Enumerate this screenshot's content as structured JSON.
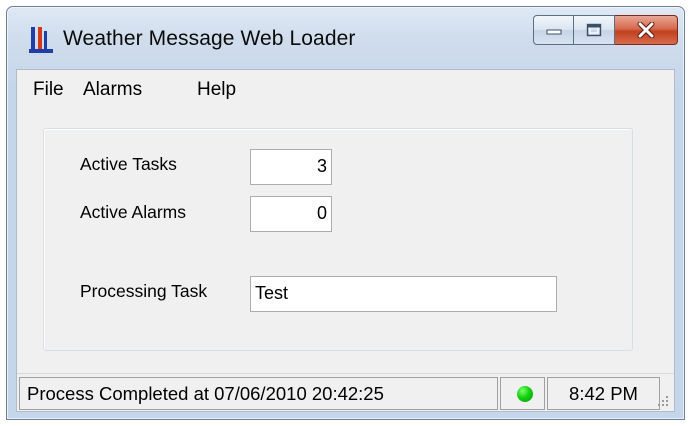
{
  "window": {
    "title": "Weather Message Web Loader",
    "icon": "app-logo-icon",
    "controls": [
      "minimize-icon",
      "maximize-icon",
      "close-icon"
    ]
  },
  "menu": {
    "items": [
      {
        "label": "File"
      },
      {
        "label": "Alarms"
      },
      {
        "label": "Help"
      }
    ]
  },
  "stats": {
    "active_tasks_label": "Active Tasks",
    "active_tasks_value": "3",
    "active_alarms_label": "Active Alarms",
    "active_alarms_value": "0",
    "processing_task_label": "Processing Task",
    "processing_task_value": "Test"
  },
  "status": {
    "message": "Process Completed at 07/06/2010 20:42:25",
    "indicator_color": "#13d10f",
    "time": "8:42 PM"
  },
  "colors": {
    "close_button": "#c1401f",
    "client_background": "#f0f0f0"
  }
}
